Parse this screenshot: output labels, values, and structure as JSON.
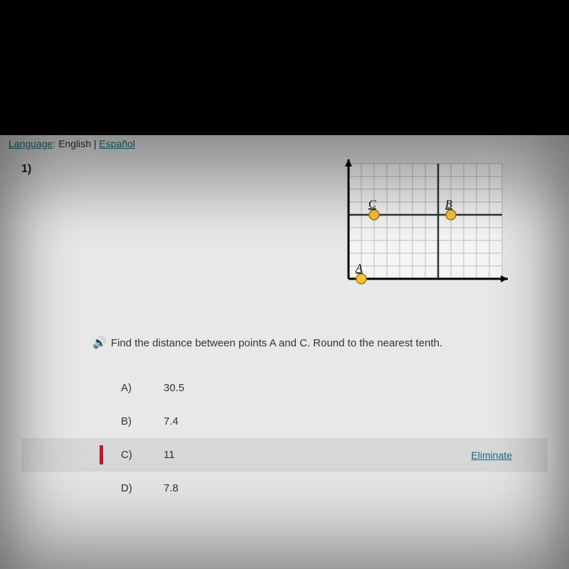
{
  "language": {
    "label": "Language",
    "current": "English",
    "separator": "|",
    "alternative": "Español"
  },
  "question_number": "1)",
  "graph": {
    "points": {
      "A": {
        "label": "A",
        "gx": 1,
        "gy": 0
      },
      "B": {
        "label": "B",
        "gx": 8,
        "gy": 5
      },
      "C": {
        "label": "C",
        "gx": 2,
        "gy": 5
      }
    }
  },
  "question_text": "Find the distance between points A and C. Round to the nearest tenth.",
  "choices": [
    {
      "letter": "A)",
      "value": "30.5",
      "selected": false
    },
    {
      "letter": "B)",
      "value": "7.4",
      "selected": false
    },
    {
      "letter": "C)",
      "value": "11",
      "selected": true
    },
    {
      "letter": "D)",
      "value": "7.8",
      "selected": false
    }
  ],
  "eliminate_label": "Eliminate",
  "chart_data": {
    "type": "scatter",
    "title": "",
    "xlabel": "",
    "ylabel": "",
    "xlim": [
      0,
      12
    ],
    "ylim": [
      0,
      9
    ],
    "series": [
      {
        "name": "A",
        "x": [
          1
        ],
        "y": [
          0
        ]
      },
      {
        "name": "B",
        "x": [
          8
        ],
        "y": [
          5
        ]
      },
      {
        "name": "C",
        "x": [
          2
        ],
        "y": [
          5
        ]
      }
    ],
    "annotations": [
      "A",
      "B",
      "C"
    ],
    "grid": true
  }
}
